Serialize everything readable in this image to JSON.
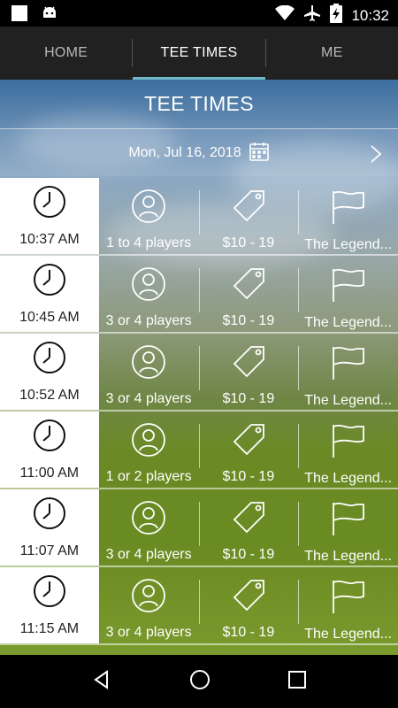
{
  "status_bar": {
    "time": "10:32",
    "icons": [
      "square-icon",
      "android-icon",
      "wifi-icon",
      "airplane-icon",
      "battery-charging-icon"
    ]
  },
  "tabs": [
    {
      "label": "HOME",
      "active": false
    },
    {
      "label": "TEE TIMES",
      "active": true
    },
    {
      "label": "ME",
      "active": false
    }
  ],
  "page": {
    "title": "TEE TIMES",
    "date": "Mon, Jul 16, 2018"
  },
  "tee_times": [
    {
      "time": "10:37 AM",
      "players": "1 to 4 players",
      "price": "$10 - 19",
      "course": "The Legend..."
    },
    {
      "time": "10:45 AM",
      "players": "3 or 4 players",
      "price": "$10 - 19",
      "course": "The Legend..."
    },
    {
      "time": "10:52 AM",
      "players": "3 or 4 players",
      "price": "$10 - 19",
      "course": "The Legend..."
    },
    {
      "time": "11:00 AM",
      "players": "1 or 2 players",
      "price": "$10 - 19",
      "course": "The Legend..."
    },
    {
      "time": "11:07 AM",
      "players": "3 or 4 players",
      "price": "$10 - 19",
      "course": "The Legend..."
    },
    {
      "time": "11:15 AM",
      "players": "3 or 4 players",
      "price": "$10 - 19",
      "course": "The Legend..."
    }
  ],
  "colors": {
    "tab_bar": "#212121",
    "tab_indicator": "#6fb7c8",
    "time_cell": "#ffffff"
  },
  "nav": [
    "back-icon",
    "home-icon",
    "recents-icon"
  ]
}
